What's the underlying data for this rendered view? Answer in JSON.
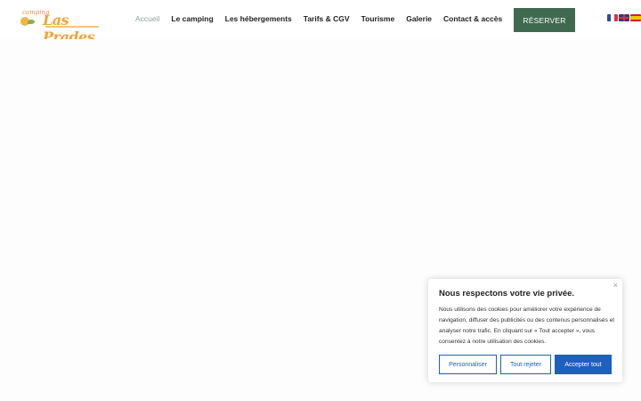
{
  "logo": {
    "small": "camping",
    "big": "Las Prades"
  },
  "nav": {
    "items": [
      "Accueil",
      "Le camping",
      "Les hébergements",
      "Tarifs & CGV",
      "Tourisme",
      "Galerie",
      "Contact & accès"
    ],
    "active_index": 0
  },
  "reserve_label": "RÉSERVER",
  "flags": [
    "fr-flag",
    "en-flag",
    "es-flag"
  ],
  "colors": {
    "accent": "#3f6a4f",
    "cookie_blue": "#1f5fbf",
    "active_nav": "#8aa79a"
  },
  "cookie": {
    "close": "×",
    "title": "Nous respectons votre vie privée.",
    "text": "Nous utilisons des cookies pour améliorer votre expérience de navigation, diffuser des publicités ou des contenus personnalisés et analyser notre trafic. En cliquant sur « Tout accepter », vous consentez à notre utilisation des cookies.",
    "customize": "Personnaliser",
    "reject": "Tout rejeter",
    "accept": "Accepter tout"
  }
}
